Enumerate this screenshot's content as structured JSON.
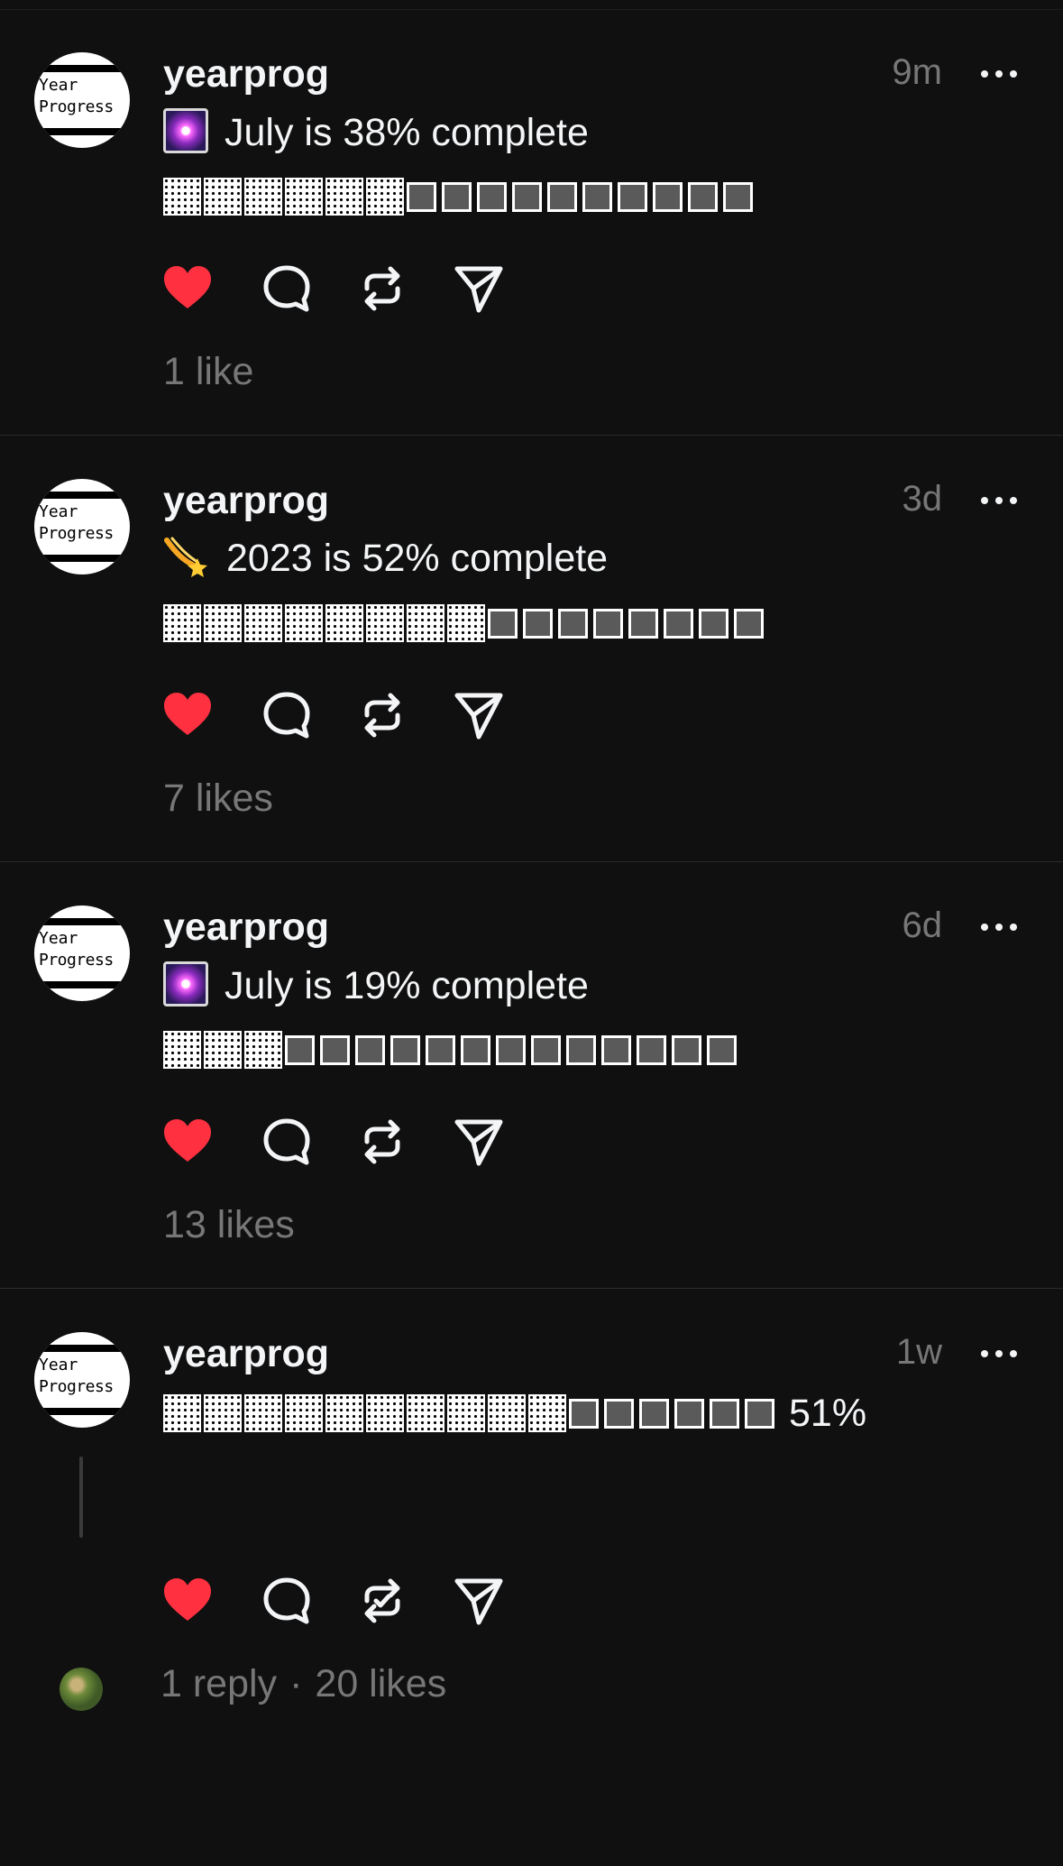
{
  "posts": [
    {
      "username": "yearprog",
      "time": "9m",
      "emoji": "firework",
      "text": "July is 38% complete",
      "filled": 6,
      "empty": 10,
      "trailing": "",
      "likes": "1 like"
    },
    {
      "username": "yearprog",
      "time": "3d",
      "emoji": "comet",
      "text": "2023 is 52% complete",
      "filled": 8,
      "empty": 8,
      "trailing": "",
      "likes": "7 likes"
    },
    {
      "username": "yearprog",
      "time": "6d",
      "emoji": "firework",
      "text": "July is 19% complete",
      "filled": 3,
      "empty": 13,
      "trailing": "",
      "likes": "13 likes"
    },
    {
      "username": "yearprog",
      "time": "1w",
      "emoji": "",
      "text": "",
      "filled": 10,
      "empty": 6,
      "trailing": "51%",
      "replies": "1 reply",
      "separator": "·",
      "likes": "20 likes"
    }
  ],
  "avatar": {
    "line1": "Year",
    "line2": "Progress"
  },
  "icons": {
    "like": "heart-icon",
    "comment": "comment-icon",
    "repost": "repost-icon",
    "share": "share-icon",
    "more": "more-icon"
  },
  "colors": {
    "like": "#ff3040",
    "muted": "#777777",
    "text": "#f3f5f7",
    "background": "#101010"
  }
}
